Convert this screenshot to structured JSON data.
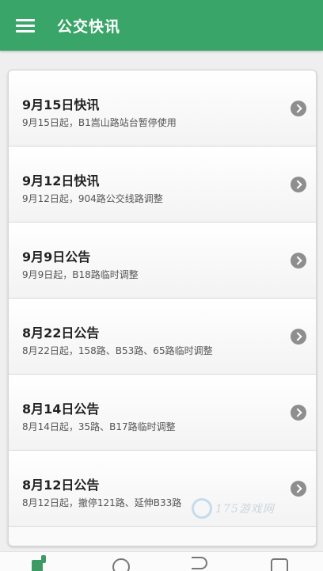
{
  "header": {
    "title": "公交快讯"
  },
  "items": [
    {
      "title": "9月15日快讯",
      "subtitle": "9月15日起，B1嵩山路站台暂停使用"
    },
    {
      "title": "9月12日快讯",
      "subtitle": "9月12日起，904路公交线路调整"
    },
    {
      "title": "9月9日公告",
      "subtitle": "9月9日起，B18路临时调整"
    },
    {
      "title": "8月22日公告",
      "subtitle": "8月22日起，158路、B53路、65路临时调整"
    },
    {
      "title": "8月14日公告",
      "subtitle": "8月14日起，35路、B17路临时调整"
    },
    {
      "title": "8月12日公告",
      "subtitle": "8月12日起，撤停121路、延伸B33路"
    }
  ],
  "watermark": {
    "text": "175游戏网"
  },
  "colors": {
    "header": "#3aa568",
    "nav_home_active": "#3d9a62"
  }
}
